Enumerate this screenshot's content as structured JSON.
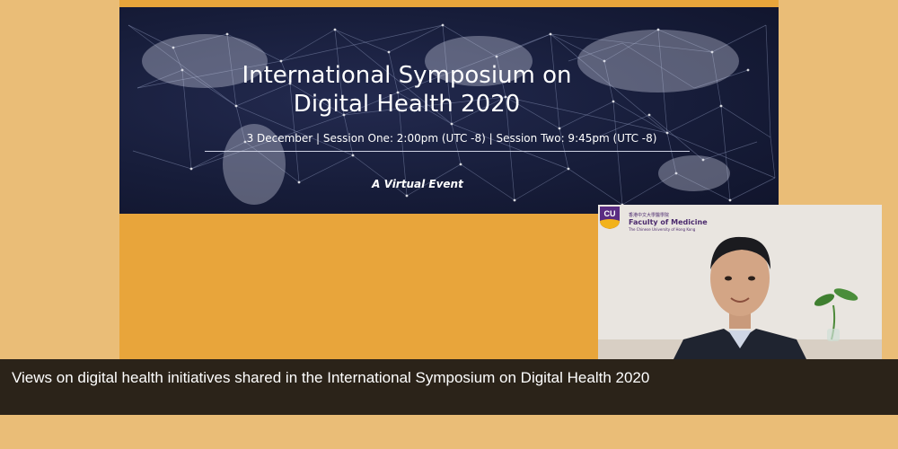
{
  "banner": {
    "title_line1": "International Symposium on",
    "title_line2": "Digital Health 2020",
    "subtitle": "3 December  |  Session One: 2:00pm (UTC -8)  |  Session Two: 9:45pm (UTC -8)",
    "event_type": "A Virtual Event"
  },
  "video": {
    "logo_text": "CU",
    "faculty_name_cn": "香港中文大學醫學院",
    "faculty_name": "Faculty of Medicine",
    "university": "The Chinese University of Hong Kong"
  },
  "caption": {
    "text": "Views on digital health initiatives shared in the International Symposium on Digital Health 2020"
  },
  "colors": {
    "page_background": "#eabd77",
    "stage_orange": "#e8a53b",
    "banner_navy": "#171d3a",
    "caption_bar": "#2b2319",
    "faculty_purple": "#4b2a6d"
  }
}
